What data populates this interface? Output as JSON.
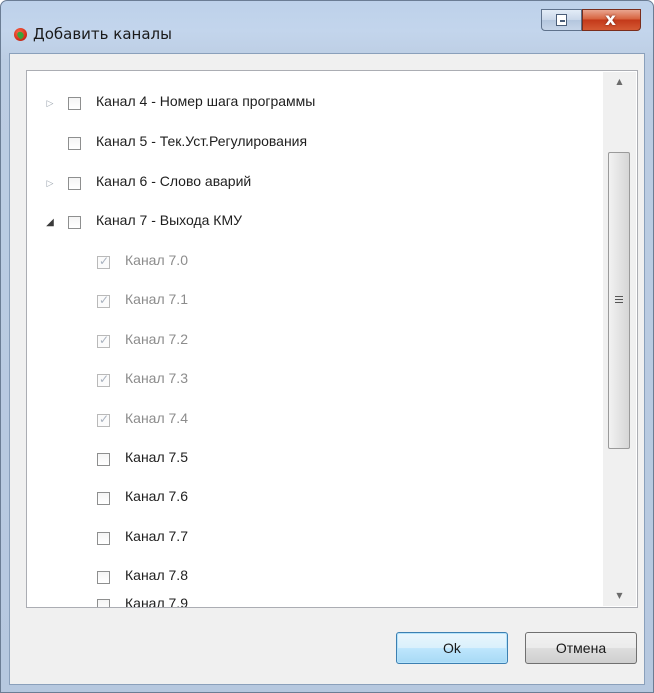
{
  "window": {
    "title": "Добавить каналы",
    "close_glyph": "x"
  },
  "tree": {
    "items": [
      {
        "label": "Канал 4 - Номер шага программы",
        "expander": "▷",
        "checked": false
      },
      {
        "label": "Канал 5 - Тек.Уст.Регулирования",
        "expander": "",
        "checked": false
      },
      {
        "label": "Канал 6 - Слово аварий",
        "expander": "▷",
        "checked": false
      },
      {
        "label": "Канал 7 - Выхода КМУ",
        "expander": "◢",
        "checked": false
      },
      {
        "label": "Канал 7.0",
        "checked": true,
        "disabled": true
      },
      {
        "label": "Канал 7.1",
        "checked": true,
        "disabled": true
      },
      {
        "label": "Канал 7.2",
        "checked": true,
        "disabled": true
      },
      {
        "label": "Канал 7.3",
        "checked": true,
        "disabled": true
      },
      {
        "label": "Канал 7.4",
        "checked": true,
        "disabled": true
      },
      {
        "label": "Канал 7.5",
        "checked": false
      },
      {
        "label": "Канал 7.6",
        "checked": false
      },
      {
        "label": "Канал 7.7",
        "checked": false
      },
      {
        "label": "Канал 7.8",
        "checked": false
      },
      {
        "label": "Канал 7.9",
        "checked": false
      }
    ]
  },
  "scrollbar": {
    "up_arrow": "▲",
    "down_arrow": "▼"
  },
  "buttons": {
    "ok_label": "Ok",
    "cancel_label": "Отмена"
  }
}
